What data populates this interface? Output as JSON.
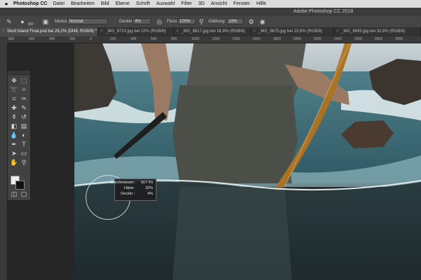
{
  "menubar": {
    "apple": "",
    "app_name": "Photoshop CC",
    "items": [
      "Datei",
      "Bearbeiten",
      "Bild",
      "Ebene",
      "Schrift",
      "Auswahl",
      "Filter",
      "3D",
      "Ansicht",
      "Fenster",
      "Hilfe"
    ]
  },
  "window": {
    "title": "Adobe Photoshop CC 2018"
  },
  "options": {
    "brush_size": "507",
    "mode_label": "Modus:",
    "mode_value": "Normal",
    "opacity_label": "Deckkr.:",
    "opacity_value": "4%",
    "flow_label": "Fluss:",
    "flow_value": "100%",
    "smoothing_label": "Glättung:",
    "smoothing_value": "10%"
  },
  "tabs": [
    {
      "label": "Skull Island Final.psd bei 26,2% (DN8, RGB/8) *"
    },
    {
      "label": "_MG_9710.jpg bei 12% (RGB/8)"
    },
    {
      "label": "_MG_9617.jpg bei 18,9% (RGB/8)"
    },
    {
      "label": "_MG_9875.jpg bei 23,9% (RGB/8)"
    },
    {
      "label": "_MG_8895.jpg bei 33,8% (RGB/8)"
    }
  ],
  "ruler_top": [
    "800",
    "600",
    "400",
    "200",
    "0",
    "200",
    "400",
    "600",
    "800",
    "1000",
    "1200",
    "1400",
    "1600",
    "1800",
    "2000",
    "2200",
    "2400",
    "2600",
    "2800",
    "3000"
  ],
  "tooltip": {
    "rows": [
      {
        "key": "Durchmesser:",
        "value": "507 Px"
      },
      {
        "key": "Härte:",
        "value": "32%"
      },
      {
        "key": "Deckkr.:",
        "value": "4%"
      }
    ]
  },
  "colors": {
    "foreground": "#eeeeee",
    "background": "#111111"
  }
}
